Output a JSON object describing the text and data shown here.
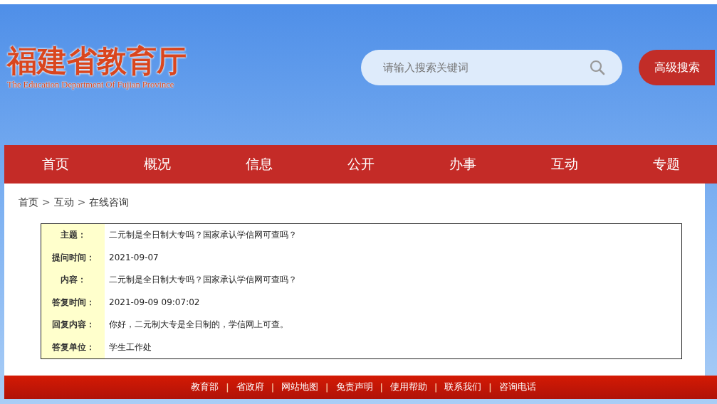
{
  "logo": {
    "title": "福建省教育厅",
    "subtitle": "The Education Department Of Fujian Province"
  },
  "search": {
    "placeholder": "请输入搜索关键词",
    "button": "高级搜索"
  },
  "nav": [
    {
      "label": "首页"
    },
    {
      "label": "概况"
    },
    {
      "label": "信息"
    },
    {
      "label": "公开"
    },
    {
      "label": "办事"
    },
    {
      "label": "互动"
    },
    {
      "label": "专题"
    }
  ],
  "breadcrumb": {
    "separator": ">",
    "items": [
      "首页",
      "互动",
      "在线咨询"
    ]
  },
  "detail": [
    {
      "label": "主题：",
      "value": "二元制是全日制大专吗？国家承认学信网可查吗？"
    },
    {
      "label": "提问时间：",
      "value": "2021-09-07"
    },
    {
      "label": "内容：",
      "value": "二元制是全日制大专吗？国家承认学信网可查吗？"
    },
    {
      "label": "答复时间：",
      "value": "2021-09-09 09:07:02"
    },
    {
      "label": "回复内容：",
      "value": "你好，二元制大专是全日制的，学信网上可查。"
    },
    {
      "label": "答复单位：",
      "value": "学生工作处"
    }
  ],
  "footer": {
    "separator": "|",
    "links": [
      "教育部",
      "省政府",
      "网站地图",
      "免责声明",
      "使用帮助",
      "联系我们",
      "咨询电话"
    ]
  }
}
